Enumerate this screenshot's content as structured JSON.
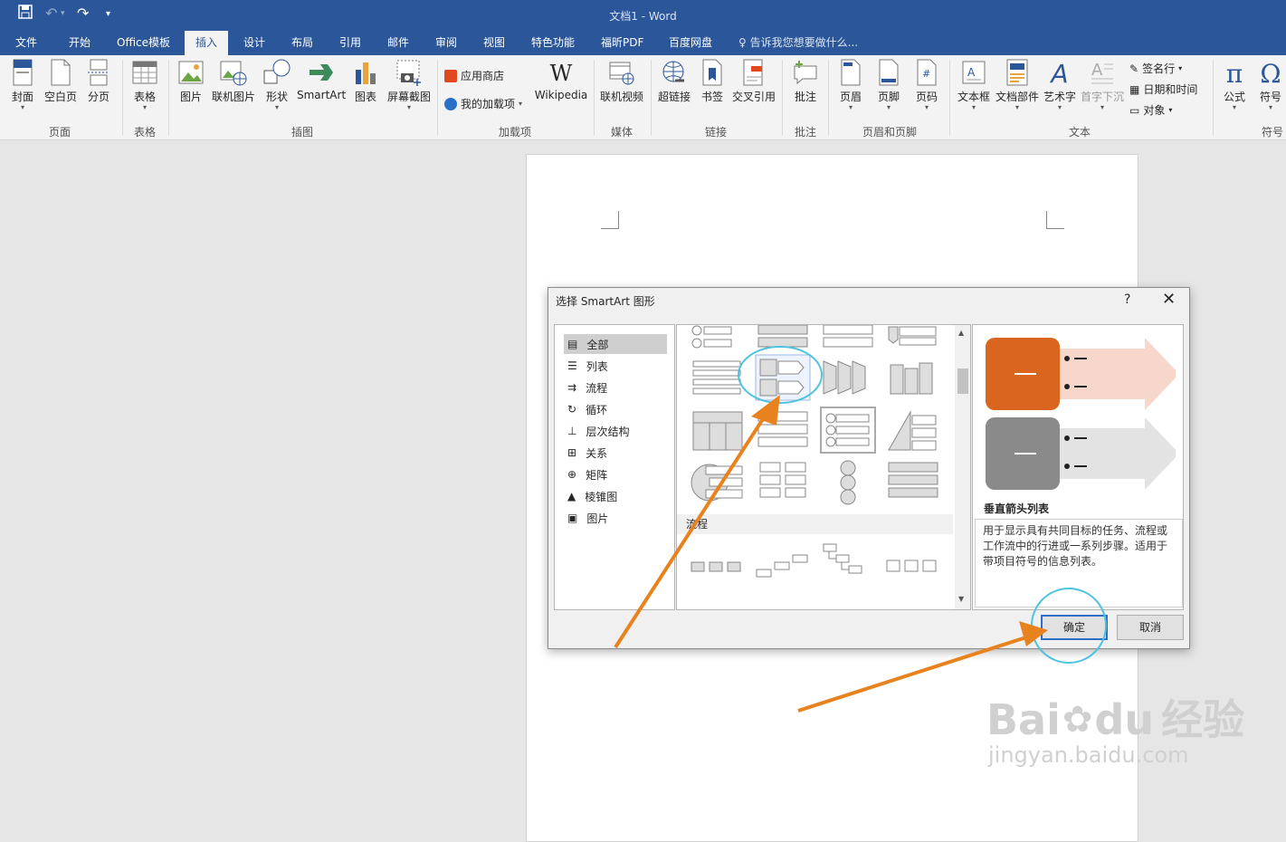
{
  "window": {
    "title": "文档1 - Word"
  },
  "menu": {
    "tabs": [
      "文件",
      "开始",
      "Office模板",
      "插入",
      "设计",
      "布局",
      "引用",
      "邮件",
      "审阅",
      "视图",
      "特色功能",
      "福昕PDF",
      "百度网盘"
    ],
    "tell_me": "告诉我您想要做什么..."
  },
  "ribbon": {
    "cover": "封面",
    "blank": "空白页",
    "page_break": "分页",
    "group_pages": "页面",
    "table": "表格",
    "group_table": "表格",
    "picture": "图片",
    "online_picture": "联机图片",
    "shapes": "形状",
    "smartart": "SmartArt",
    "chart": "图表",
    "screenshot": "屏幕截图",
    "group_illustrations": "插图",
    "store": "应用商店",
    "my_addins": "我的加载项",
    "wikipedia": "Wikipedia",
    "group_addins": "加载项",
    "online_video": "联机视频",
    "group_media": "媒体",
    "hyperlink": "超链接",
    "bookmark": "书签",
    "cross_ref": "交叉引用",
    "group_links": "链接",
    "comment": "批注",
    "group_comments": "批注",
    "header": "页眉",
    "footer": "页脚",
    "page_number": "页码",
    "group_header_footer": "页眉和页脚",
    "textbox": "文本框",
    "quick_parts": "文档部件",
    "wordart": "艺术字",
    "drop_cap": "首字下沉",
    "signature": "签名行",
    "date_time": "日期和时间",
    "object": "对象",
    "group_text": "文本",
    "equation": "公式",
    "symbol": "符号",
    "group_symbols": "符号"
  },
  "dialog": {
    "title": "选择 SmartArt 图形",
    "help": "?",
    "categories": [
      {
        "label": "全部",
        "icon": "all-icon"
      },
      {
        "label": "列表",
        "icon": "list-icon"
      },
      {
        "label": "流程",
        "icon": "process-icon"
      },
      {
        "label": "循环",
        "icon": "cycle-icon"
      },
      {
        "label": "层次结构",
        "icon": "hierarchy-icon"
      },
      {
        "label": "关系",
        "icon": "relationship-icon"
      },
      {
        "label": "矩阵",
        "icon": "matrix-icon"
      },
      {
        "label": "棱锥图",
        "icon": "pyramid-icon"
      },
      {
        "label": "图片",
        "icon": "picture-icon"
      }
    ],
    "selected_category": "全部",
    "gallery_section": "流程",
    "preview_name": "垂直箭头列表",
    "preview_description": "用于显示具有共同目标的任务、流程或工作流中的行进或一系列步骤。适用于带项目符号的信息列表。",
    "ok": "确定",
    "cancel": "取消"
  },
  "colors": {
    "accent": "#2b579a",
    "annotation_arrow": "#e8821e",
    "highlight_circle": "#4ec3e0",
    "preview_orange": "#d9651f",
    "preview_gray": "#8a8a8a"
  },
  "watermark": {
    "brand": "Bai",
    "brand2": "du",
    "product": "经验",
    "url": "jingyan.baidu.com"
  }
}
